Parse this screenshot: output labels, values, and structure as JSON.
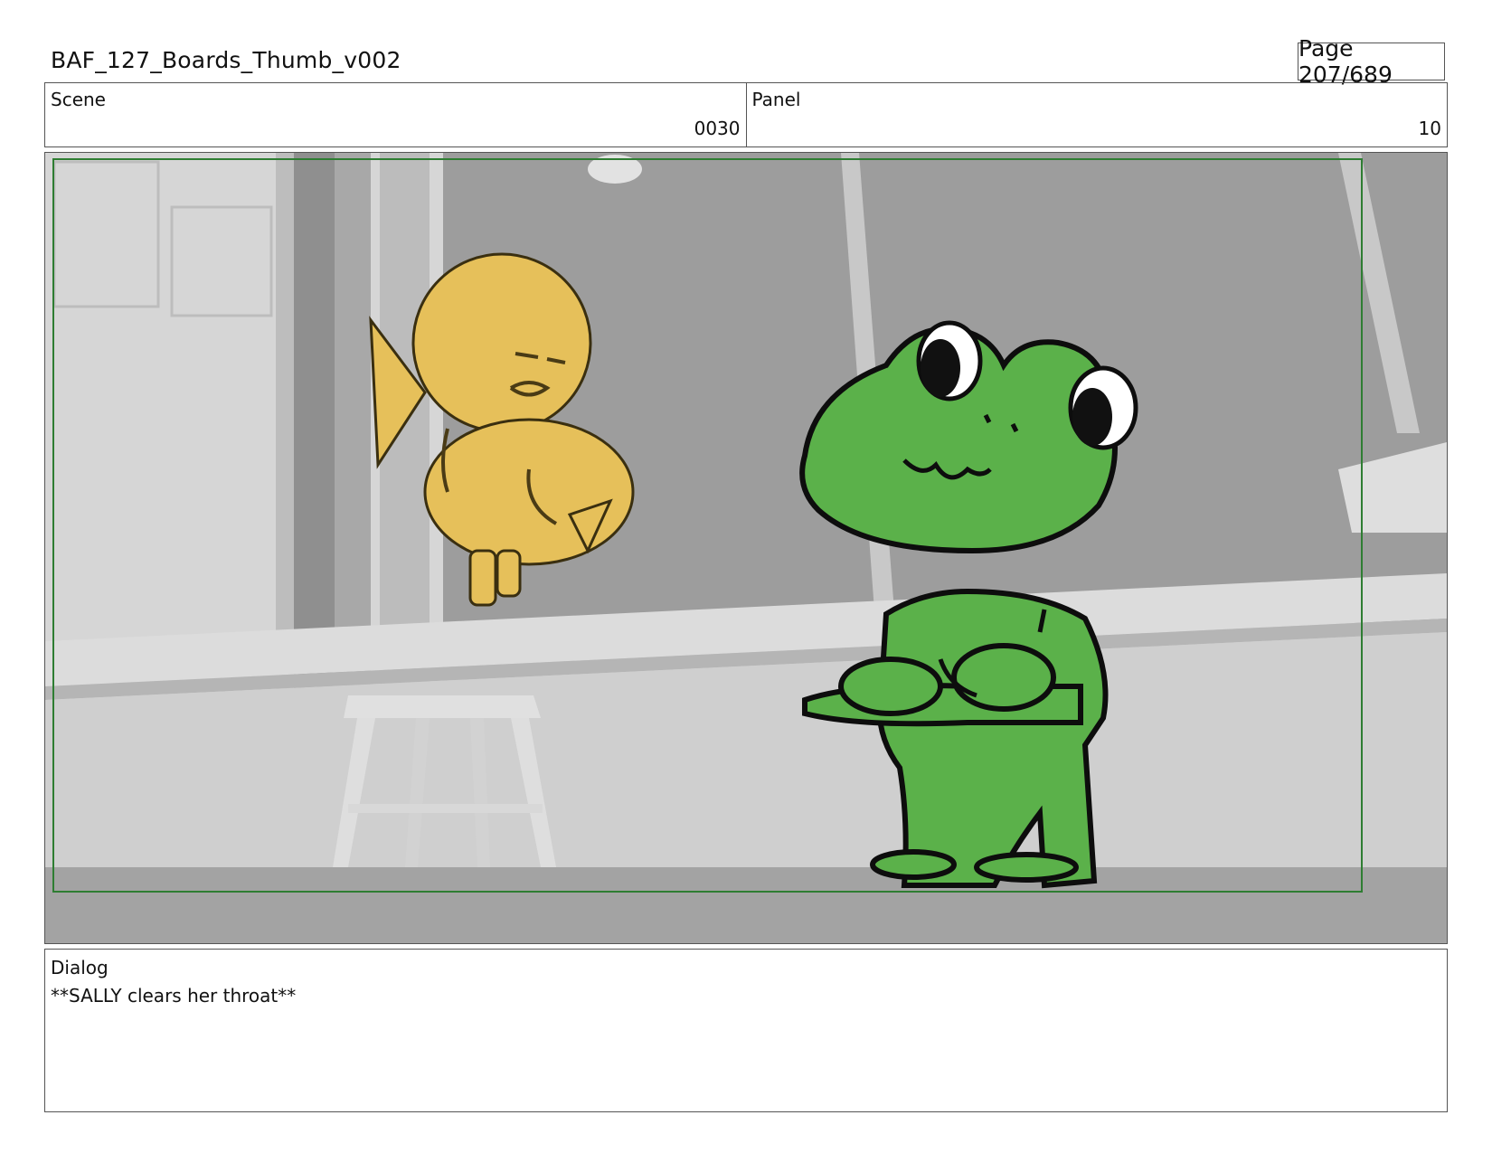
{
  "header": {
    "title": "BAF_127_Boards_Thumb_v002",
    "page": "Page 207/689"
  },
  "scene": {
    "label": "Scene",
    "value": "0030"
  },
  "panel": {
    "label": "Panel",
    "value": "10"
  },
  "dialog": {
    "label": "Dialog",
    "text": "**SALLY clears her throat**"
  },
  "colors": {
    "frog": "#5bb14a",
    "duck": "#e6c05a",
    "safe_frame": "#2e7d32"
  }
}
